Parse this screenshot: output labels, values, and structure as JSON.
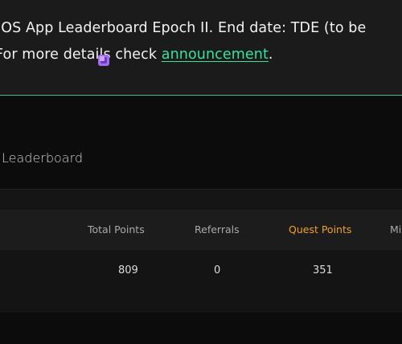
{
  "banner": {
    "line1": "dOS App Leaderboard Epoch II. End date: TDE (to be",
    "line2_prefix": "For more details check ",
    "link": "announcement",
    "line2_suffix": ".",
    "accent": "#38e29e"
  },
  "leaderboard": {
    "title": "Leaderboard",
    "columns": [
      "Total Points",
      "Referrals",
      "Quest Points",
      "Mi"
    ],
    "quest_color": "#f0a02a",
    "rows": [
      {
        "total_points": "809",
        "referrals": "0",
        "quest_points": "351",
        "icon": "points-gem-icon"
      }
    ]
  }
}
